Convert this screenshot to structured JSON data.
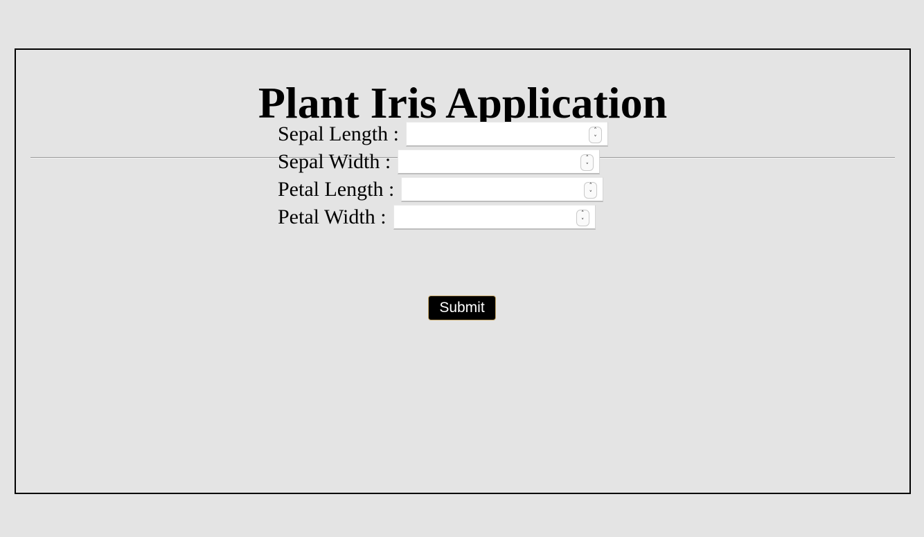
{
  "page": {
    "title": "Plant Iris Application"
  },
  "form": {
    "fields": [
      {
        "label": "Sepal Length :",
        "value": ""
      },
      {
        "label": "Sepal Width :",
        "value": ""
      },
      {
        "label": "Petal Length :",
        "value": ""
      },
      {
        "label": "Petal Width :",
        "value": ""
      }
    ],
    "submit_label": "Submit"
  },
  "icons": {
    "spinner_up": "chevron-up-icon",
    "spinner_down": "chevron-down-icon"
  },
  "colors": {
    "background": "#e4e4e4",
    "submit_bg": "#000000",
    "submit_text": "#ffffff"
  }
}
